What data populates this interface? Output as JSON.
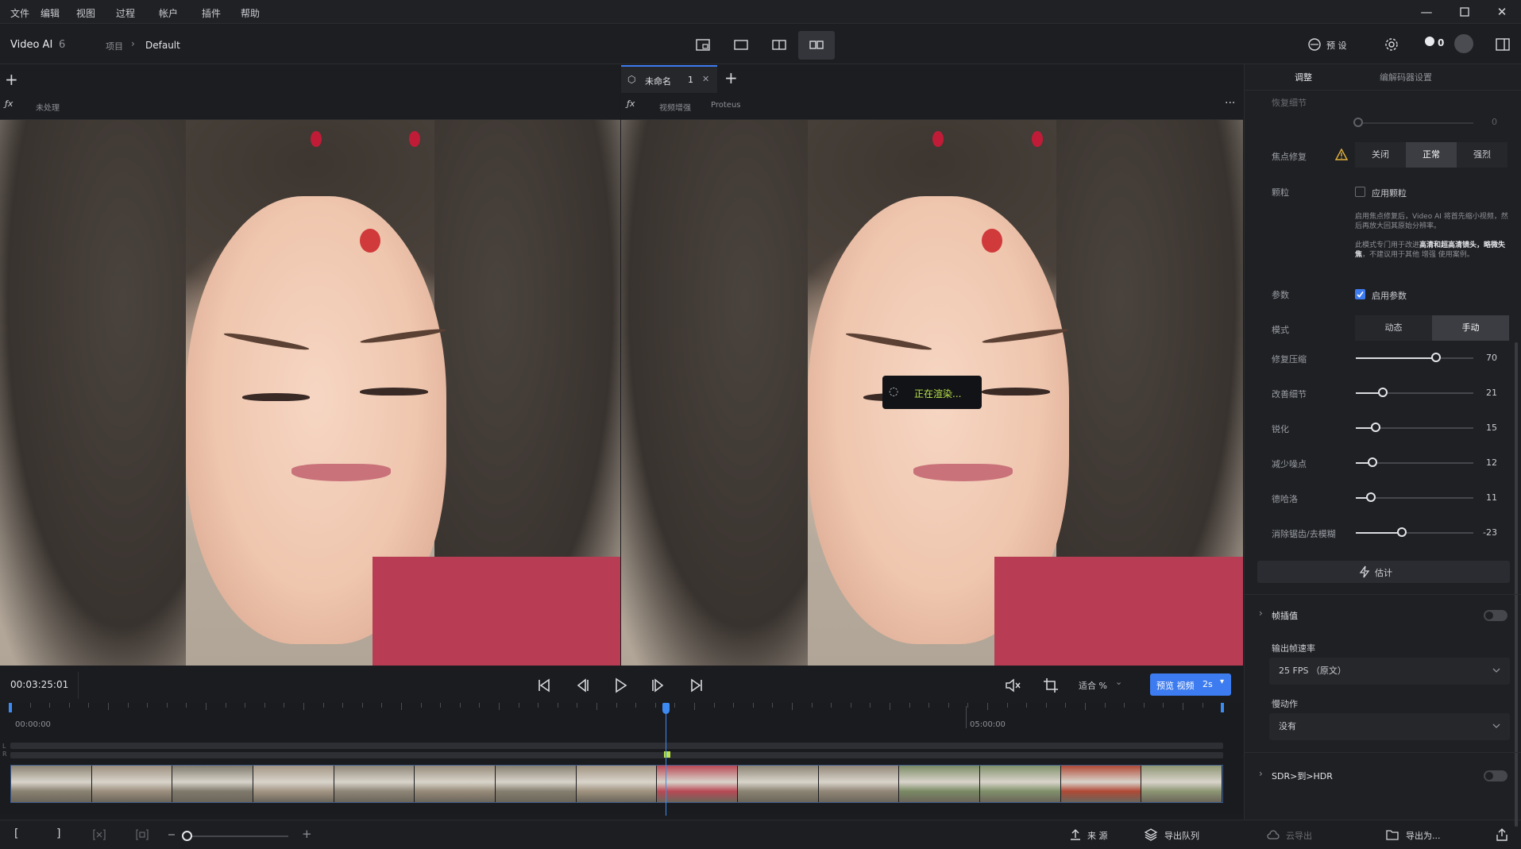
{
  "menu": [
    "文件",
    "编辑",
    "视图",
    "过程",
    "帐户",
    "插件",
    "帮助"
  ],
  "app": {
    "name": "Video AI",
    "version": "6",
    "breadcrumb_root": "项目",
    "breadcrumb_current": "Default",
    "presets_label": "预 设",
    "credits": "0"
  },
  "left_pane": {
    "fx_label": "未处理"
  },
  "right_pane": {
    "tab_name": "未命名",
    "tab_count": "1",
    "fx_label": "视频增强",
    "model": "Proteus",
    "more": "···",
    "rendering": "正在渲染..."
  },
  "transport": {
    "timecode": "00:03:25:01",
    "zoom_label": "适合 %",
    "preview_label": "预览 视频",
    "preview_duration": "2s"
  },
  "timeline": {
    "start_label": "00:00:00",
    "mid_label": "05:00:00",
    "playhead_fraction": 0.54,
    "thumbnail_count": 15,
    "lane_label_l": "L",
    "lane_label_r": "R"
  },
  "bottom": {
    "bracket_open": "[",
    "bracket_close": "]",
    "source_label": "来 源",
    "queue_label": "导出队列",
    "cloud_export_label": "云导出",
    "export_label": "导出为..."
  },
  "panel": {
    "tab_adjust": "调整",
    "tab_codec": "编解码器设置",
    "restore_detail": {
      "label": "恢复细节",
      "value": "0",
      "fraction": 0.0
    },
    "focus_fix": {
      "label": "焦点修复",
      "options": [
        "关闭",
        "正常",
        "强烈"
      ],
      "selected": "正常"
    },
    "grain": {
      "label": "颗粒",
      "checkbox_label": "应用颗粒",
      "checked": false
    },
    "note_1": "启用焦点修复后，Video AI 将首先缩小视频，然后再放大回其原始分辨率。",
    "note_2a": "此模式专门用于改进",
    "note_2b": "高清和超高清镜头，",
    "note_2c": "略微失焦",
    "note_2d": "，不建议用于其他 增强 使用案例。",
    "params": {
      "label": "参数",
      "checkbox_label": "启用参数",
      "checked": true
    },
    "mode": {
      "label": "模式",
      "options": [
        "动态",
        "手动"
      ],
      "selected": "手动"
    },
    "sliders": [
      {
        "label": "修复压缩",
        "value": "70",
        "fraction": 0.68
      },
      {
        "label": "改善细节",
        "value": "21",
        "fraction": 0.23
      },
      {
        "label": "锐化",
        "value": "15",
        "fraction": 0.17
      },
      {
        "label": "减少噪点",
        "value": "12",
        "fraction": 0.14
      },
      {
        "label": "德哈洛",
        "value": "11",
        "fraction": 0.13
      },
      {
        "label": "消除锯齿/去模糊",
        "value": "-23",
        "fraction": 0.39
      }
    ],
    "estimate_label": "估计",
    "frame_interp": {
      "label": "帧插值",
      "enabled": false
    },
    "output_fps": {
      "label": "输出帧速率",
      "value": "25 FPS （原文）"
    },
    "slow_motion": {
      "label": "慢动作",
      "value": "没有"
    },
    "sdr_hdr": {
      "label": "SDR>到>HDR",
      "enabled": false
    }
  },
  "colors": {
    "accent_blue": "#3d7cf0",
    "render_text": "#b8e34a",
    "playhead": "#3d8bf2",
    "warning": "#e2b23c"
  }
}
